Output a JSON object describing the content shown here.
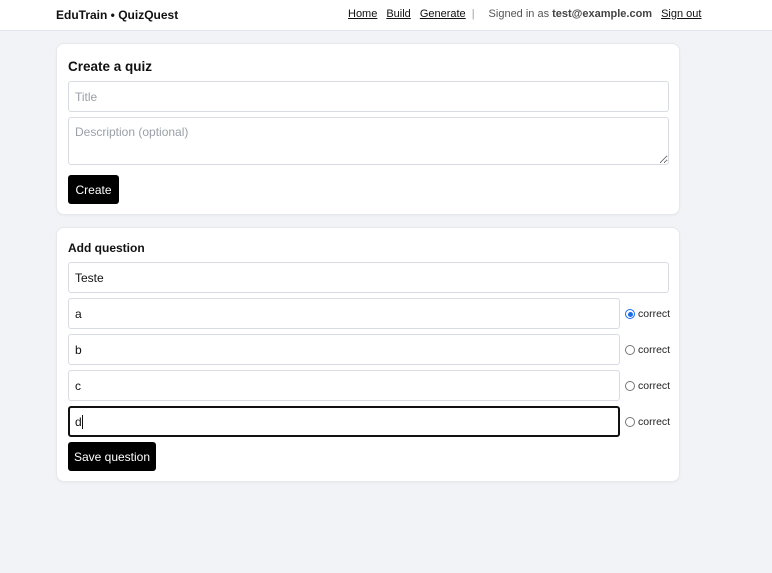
{
  "header": {
    "brand": "EduTrain • QuizQuest",
    "nav": [
      "Home",
      "Build",
      "Generate"
    ],
    "separator": "|",
    "signed_in_prefix": "Signed in as",
    "email": "test@example.com",
    "sign_out": "Sign out"
  },
  "create_quiz": {
    "title": "Create a quiz",
    "title_placeholder": "Title",
    "title_value": "",
    "description_placeholder": "Description (optional)",
    "description_value": "",
    "create_label": "Create"
  },
  "add_question": {
    "title": "Add question",
    "question_value": "Teste",
    "options": [
      {
        "value": "a",
        "correct_label": "correct",
        "checked": true
      },
      {
        "value": "b",
        "correct_label": "correct",
        "checked": false
      },
      {
        "value": "c",
        "correct_label": "correct",
        "checked": false
      },
      {
        "value": "d",
        "correct_label": "correct",
        "checked": false
      }
    ],
    "save_label": "Save question"
  },
  "colors": {
    "background": "#f1f3f7",
    "button": "#000000",
    "radio_checked": "#1a6ce8"
  }
}
